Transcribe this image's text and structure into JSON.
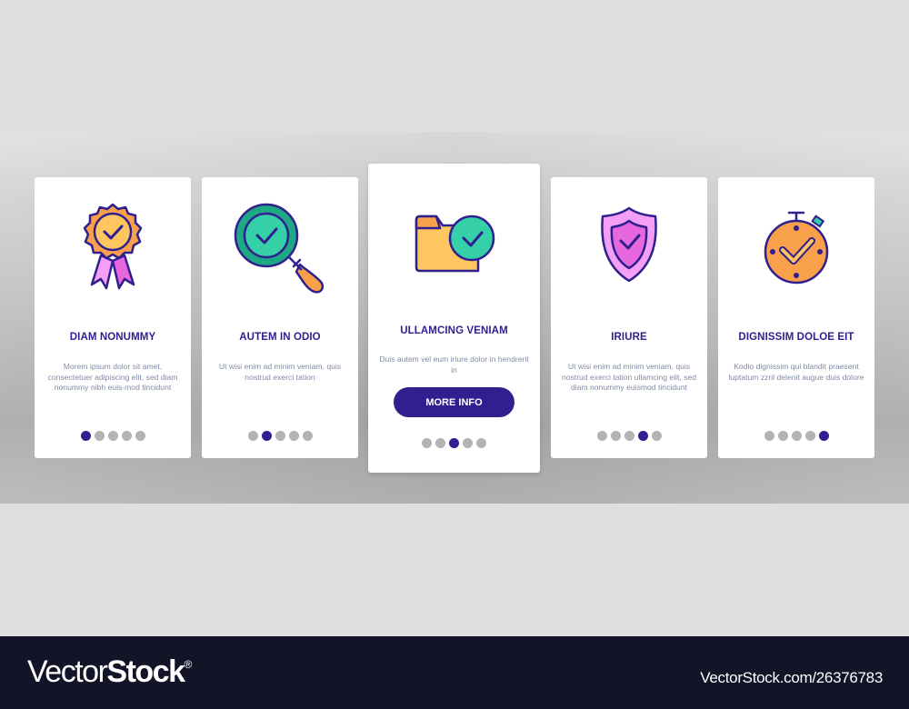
{
  "colors": {
    "accent": "#2f1f8f",
    "text_muted": "#7f8aa3",
    "dot_inactive": "#b3b3b3",
    "footer_bg": "#131428"
  },
  "cards": [
    {
      "icon": "award-ribbon-check-icon",
      "title": "DIAM NONUMMY",
      "description": "Morem ipsum dolor sit amet, consectetuer adipiscing elit, sed diam nonummy nibh euis-mod tincidunt",
      "active_dot": 1,
      "total_dots": 5
    },
    {
      "icon": "magnifier-check-icon",
      "title": "AUTEM IN ODIO",
      "description": "Ut wisi enim ad minim veniam, quis nostrud exerci tation",
      "active_dot": 2,
      "total_dots": 5
    },
    {
      "icon": "folder-check-icon",
      "title": "ULLAMCING VENIAM",
      "description": "Duis autem vel eum iriure dolor in hendrerit in",
      "button_label": "MORE INFO",
      "active_dot": 3,
      "total_dots": 5
    },
    {
      "icon": "shield-check-icon",
      "title": "IRIURE",
      "description": "Ut wisi enim ad minim veniam, quis nostrud exerci tation ullamcing elit, sed diam nonummy euismod tincidunt",
      "active_dot": 4,
      "total_dots": 5
    },
    {
      "icon": "stopwatch-check-icon",
      "title": "DIGNISSIM DOLOE EIT",
      "description": "Kodio dignissim qui blandit praesent luptatum zzril delenit augue duis dolore",
      "active_dot": 5,
      "total_dots": 5
    }
  ],
  "footer": {
    "logo_light": "Vector",
    "logo_bold": "Stock",
    "logo_mark": "®",
    "image_id_text": "VectorStock.com/26376783"
  }
}
